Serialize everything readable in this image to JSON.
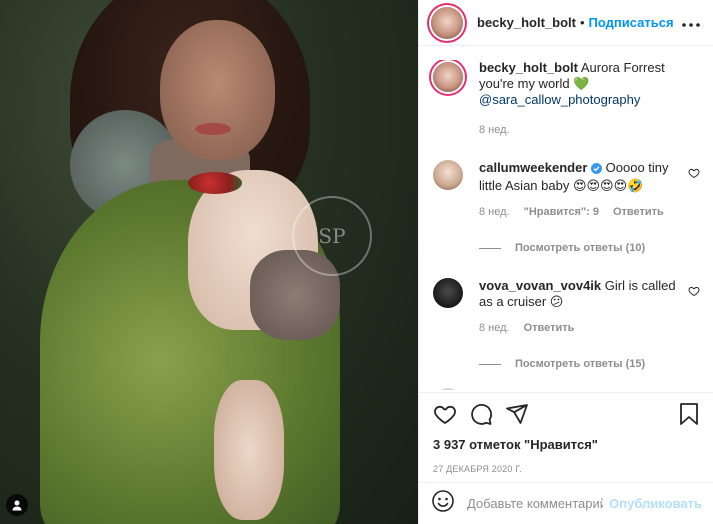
{
  "post": {
    "author": "becky_holt_bolt",
    "separator": "•",
    "follow_label": "Подписаться",
    "more_icon": "more-horizontal-icon",
    "watermark": "SP",
    "caption": {
      "text": "Aurora Forrest you're my world",
      "emoji": "💚",
      "mention": "@sara_callow_photography",
      "time": "8 нед."
    }
  },
  "comments": [
    {
      "author": "callumweekender",
      "verified": true,
      "text": "Ooooo tiny little Asian baby 😍😍😍😍🤣",
      "time": "8 нед.",
      "likes": "\"Нравится\": 9",
      "reply_label": "Ответить",
      "view_replies": "Посмотреть ответы (10)"
    },
    {
      "author": "vova_vovan_vov4ik",
      "verified": false,
      "text": "Girl is called as a cruiser 😕",
      "time": "8 нед.",
      "reply_label": "Ответить",
      "view_replies": "Посмотреть ответы (15)"
    }
  ],
  "actions": {
    "likes_count": "3 937 отметок \"Нравится\"",
    "date": "27 ДЕКАБРЯ 2020 Г."
  },
  "add_comment": {
    "placeholder": "Добавьте комментарий...",
    "publish_label": "Опубликовать"
  },
  "colors": {
    "accent": "#0095f6",
    "link": "#00376b",
    "muted": "#8e8e8e",
    "publish_disabled": "#b2dffc",
    "heart_emoji": "#3cb543"
  }
}
